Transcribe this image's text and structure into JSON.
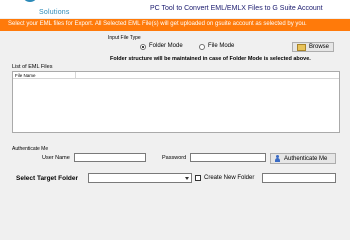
{
  "header": {
    "brand_sub": "Solutions",
    "app_title": "PC Tool to Convert EML/EMLX Files to G Suite Account"
  },
  "banner": {
    "text": "Select your EML files for Export. All Selected EML File(s) will get uploaded on gsuite account as selected by you."
  },
  "input_type": {
    "label": "Input File Type",
    "options": [
      {
        "label": "Folder Mode",
        "selected": true
      },
      {
        "label": "File Mode",
        "selected": false
      }
    ]
  },
  "browse_button": {
    "label": "Browse",
    "icon": "folder-icon"
  },
  "folder_note": "Folder structure will be maintained in case of Folder Mode is selected above.",
  "eml_list": {
    "title": "List of EML Files",
    "columns": [
      "File Name"
    ],
    "rows": []
  },
  "auth": {
    "title": "Authenticate Me",
    "username_label": "User Name",
    "username_value": "",
    "password_label": "Password",
    "password_value": "",
    "button_label": "Authenticate Me",
    "button_icon": "user-icon"
  },
  "target": {
    "label": "Select Target Folder",
    "selected_value": "",
    "create_checkbox_label": "Create New Folder",
    "create_checked": false,
    "new_folder_value": ""
  },
  "colors": {
    "banner": "#ff7a0a",
    "title_text": "#1a1a6e",
    "brand": "#2b8ab8"
  }
}
